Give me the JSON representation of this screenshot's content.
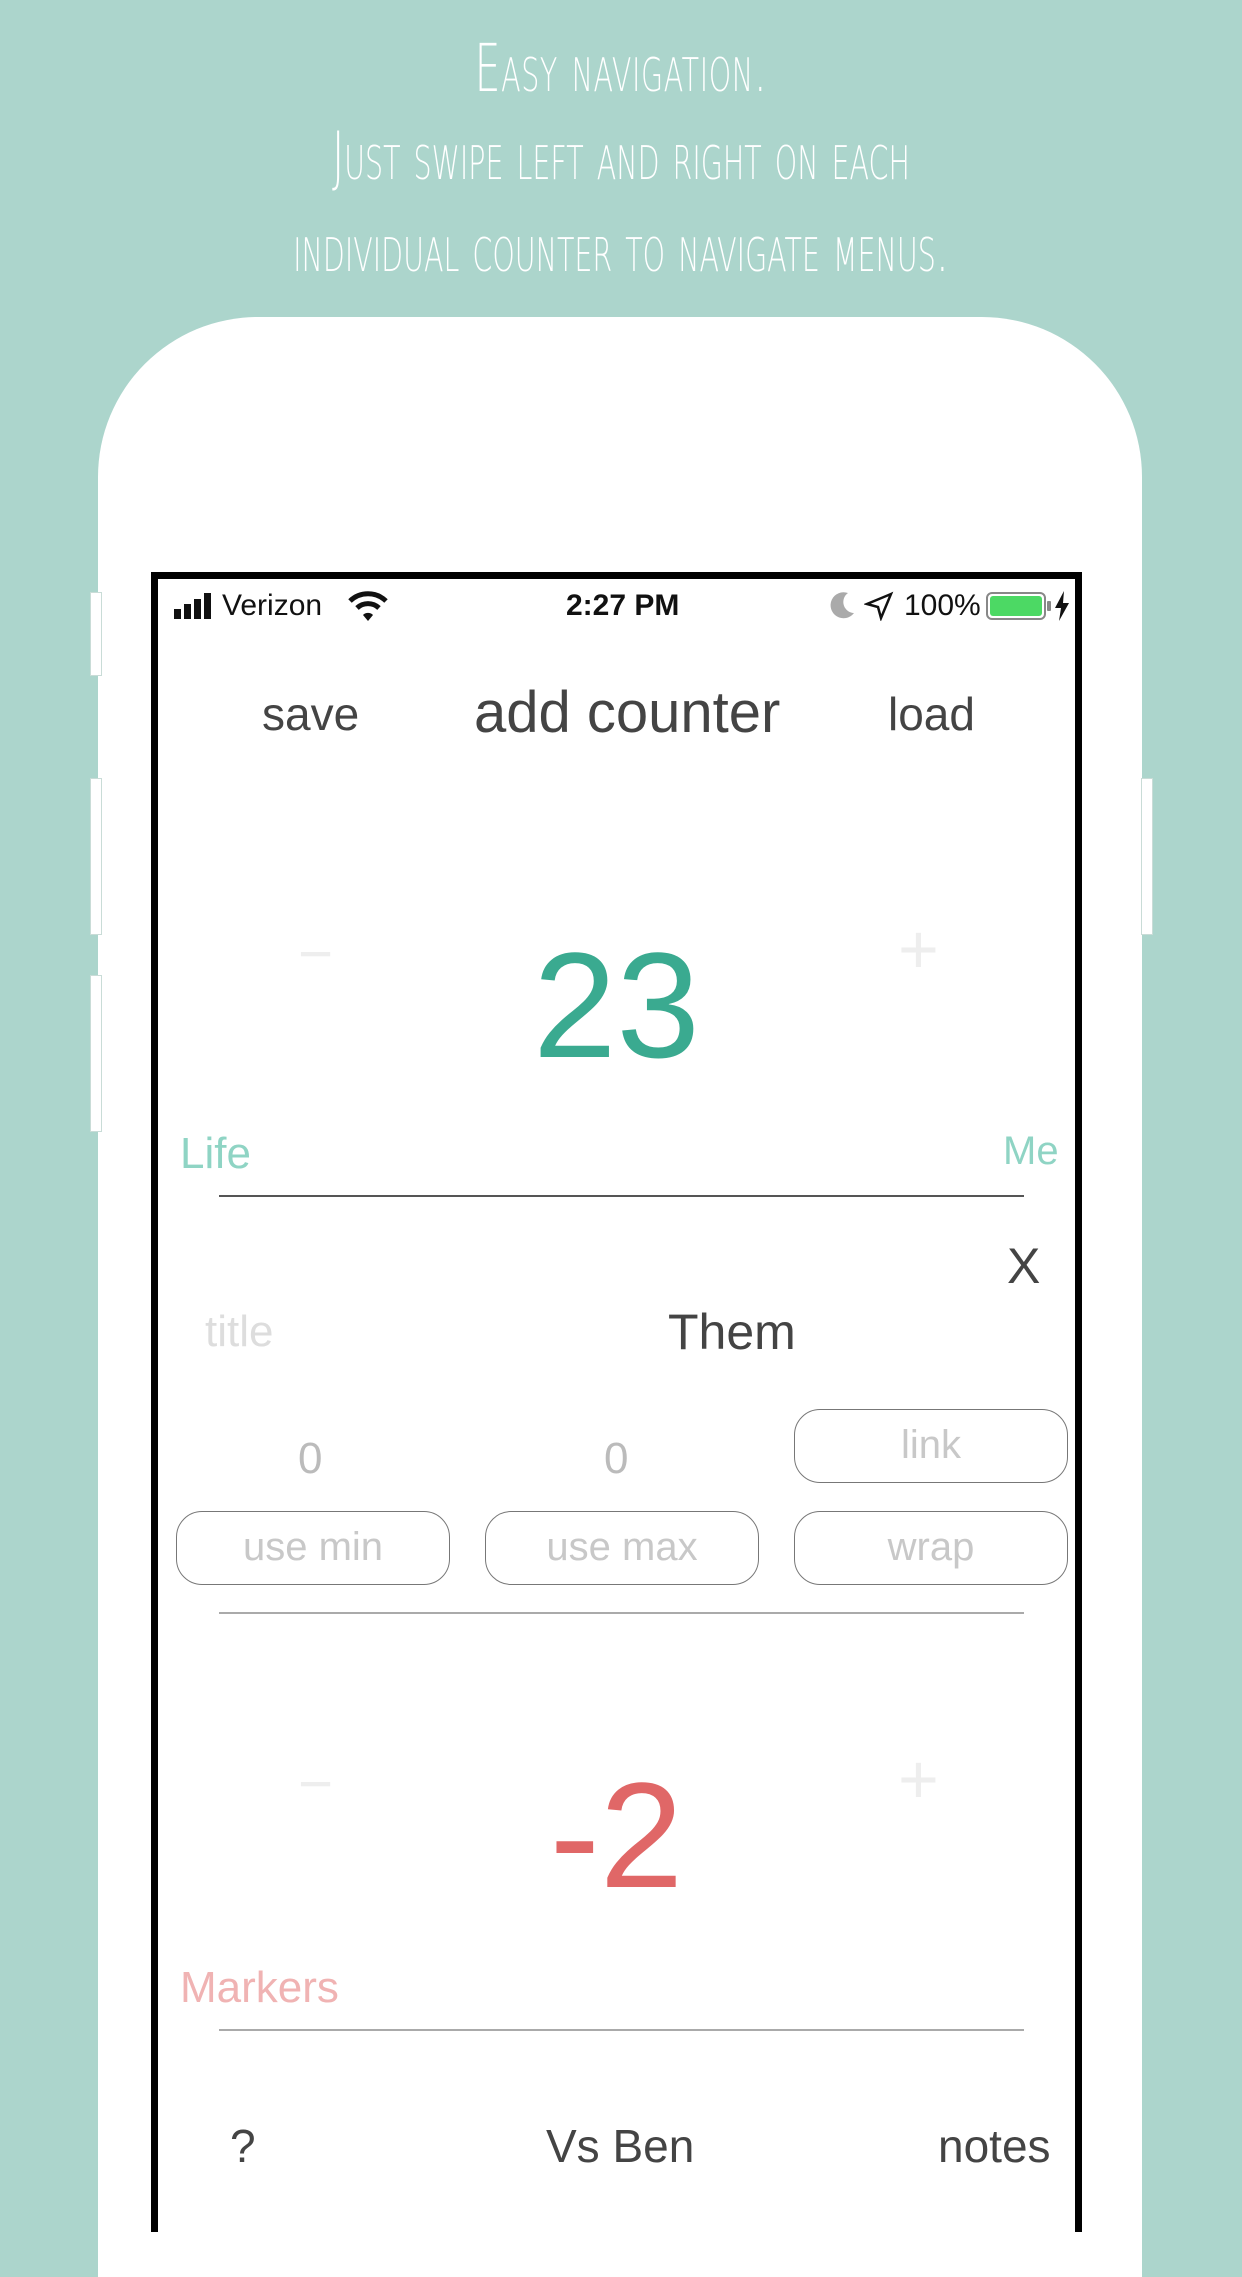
{
  "caption": {
    "line1": "Easy navigation.",
    "line2": "Just swipe left and right on each",
    "line3": "individual counter to navigate menus."
  },
  "status_bar": {
    "carrier": "Verizon",
    "time": "2:27 PM",
    "battery": "100%",
    "icons": [
      "signal-bars-icon",
      "wifi-icon",
      "moon-icon",
      "location-arrow-icon",
      "battery-icon",
      "charging-bolt-icon"
    ],
    "battery_color": "#4cd964"
  },
  "top_bar": {
    "save": "save",
    "add": "add counter",
    "load": "load"
  },
  "counter1": {
    "minus": "−",
    "plus": "+",
    "value": "23",
    "label_left": "Life",
    "label_right": "Me",
    "value_color": "#3aaa90"
  },
  "settings": {
    "close": "X",
    "title_placeholder": "title",
    "title_value": "Them",
    "min_value": "0",
    "max_value": "0",
    "link_label": "link",
    "use_min_label": "use min",
    "use_max_label": "use max",
    "wrap_label": "wrap"
  },
  "counter2": {
    "minus": "−",
    "plus": "+",
    "value": "-2",
    "label_left": "Markers",
    "value_color": "#e06767"
  },
  "bottom_bar": {
    "help": "?",
    "title": "Vs Ben",
    "notes": "notes"
  }
}
